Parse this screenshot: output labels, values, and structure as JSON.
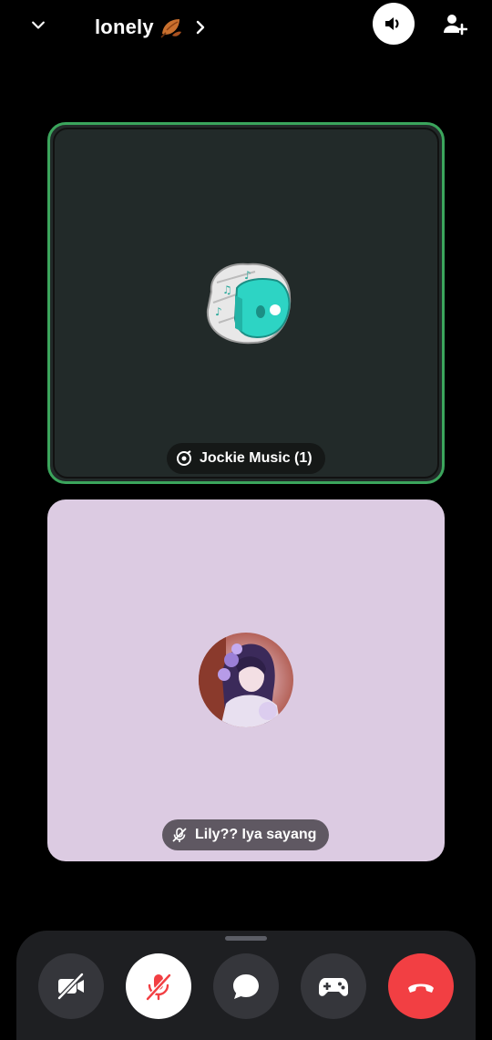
{
  "header": {
    "channel_name": "lonely",
    "channel_emoji": "fallen-leaf-icon"
  },
  "tiles": [
    {
      "name": "Jockie Music (1)",
      "status_icon": "headset-music-icon",
      "speaking": true,
      "accent": "#3ba55c",
      "background": "#222a29"
    },
    {
      "name": "Lily?? Iya sayang",
      "status_icon": "mic-muted-icon",
      "speaking": false,
      "background": "#dccbe2"
    }
  ],
  "controls": [
    {
      "name": "camera-off",
      "icon": "video-off-icon"
    },
    {
      "name": "microphone",
      "icon": "mic-off-icon",
      "state": "muted"
    },
    {
      "name": "chat",
      "icon": "chat-bubble-icon"
    },
    {
      "name": "activities",
      "icon": "gamepad-icon"
    },
    {
      "name": "disconnect",
      "icon": "phone-hangup-icon",
      "color": "#f23f43"
    }
  ],
  "colors": {
    "speaking_ring": "#3ba55c",
    "danger": "#f23f43",
    "bot_teal": "#2dd4c4"
  }
}
